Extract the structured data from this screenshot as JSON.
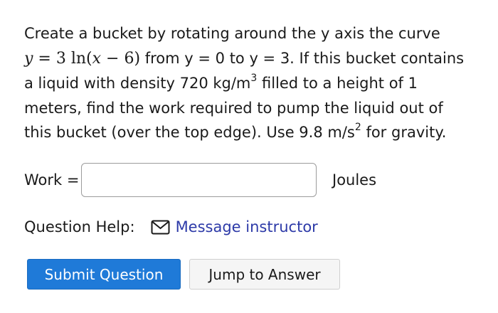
{
  "question": {
    "line1": "Create a bucket by rotating around the y axis the curve",
    "math_y": "y",
    "math_eq": " = 3 ln(",
    "math_x": "x",
    "math_rest": " − 6)",
    "line2_rest": " from y = 0 to y = 3. If this bucket contains",
    "line3_pre": "a liquid with density 720 kg/m",
    "line3_sup": "3",
    "line3_post": " filled to a height of 1",
    "line4": "meters, find the work required to pump the liquid out of",
    "line5_pre": "this bucket (over the top edge). Use 9.8 m/s",
    "line5_sup": "2",
    "line5_post": " for gravity."
  },
  "work": {
    "label": "Work =",
    "value": "",
    "unit": "Joules"
  },
  "help": {
    "label": "Question Help:",
    "link_icon": "mail-icon",
    "link_label": "Message instructor"
  },
  "buttons": {
    "submit_label": "Submit Question",
    "jump_label": "Jump to Answer"
  },
  "colors": {
    "submit_bg": "#1f7ad8",
    "link": "#2d3aa8"
  }
}
